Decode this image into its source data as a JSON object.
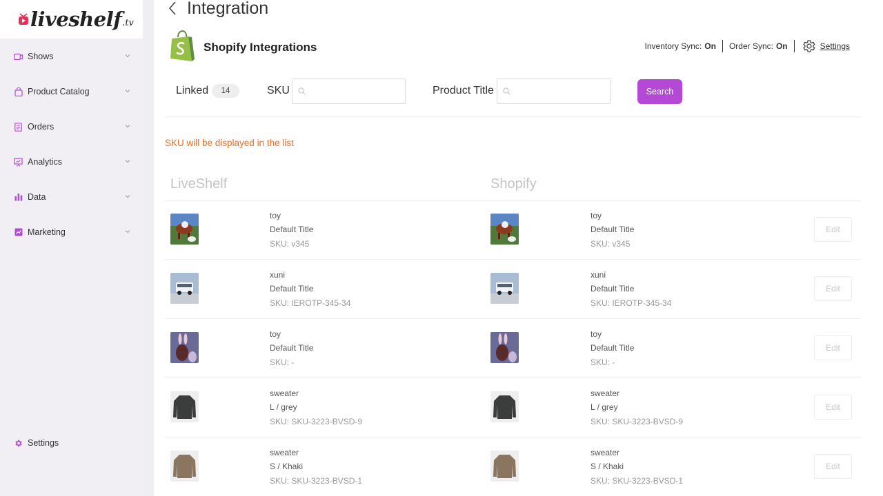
{
  "brand": {
    "name": "liveshelf",
    "tld": ".tv"
  },
  "sidebar": {
    "items": [
      {
        "label": "Shows",
        "icon": "video-icon"
      },
      {
        "label": "Product Catalog",
        "icon": "shopping-bag-icon"
      },
      {
        "label": "Orders",
        "icon": "document-icon"
      },
      {
        "label": "Analytics",
        "icon": "presentation-chart-icon"
      },
      {
        "label": "Data",
        "icon": "bar-chart-icon"
      },
      {
        "label": "Marketing",
        "icon": "trend-chart-icon"
      }
    ],
    "settings_label": "Settings"
  },
  "header": {
    "title": "Integration",
    "section_title": "Shopify Integrations",
    "inventory_sync_label": "Inventory Sync:",
    "inventory_sync_value": "On",
    "order_sync_label": "Order Sync:",
    "order_sync_value": "On",
    "settings_link": "Settings"
  },
  "filters": {
    "linked_label": "Linked",
    "linked_count": "14",
    "sku_label": "SKU",
    "sku_value": "",
    "title_label": "Product Title",
    "title_value": "",
    "search_button": "Search"
  },
  "notice": "SKU will be displayed in the list",
  "columns": {
    "left": "LiveShelf",
    "right": "Shopify"
  },
  "edit_label": "Edit",
  "colors": {
    "accent": "#b449d6",
    "notice": "#ef6c1e"
  },
  "rows": [
    {
      "name": "toy",
      "variant": "Default Title",
      "sku": "SKU: v345",
      "image": "cow"
    },
    {
      "name": "xuni",
      "variant": "Default Title",
      "sku": "SKU: IEROTP-345-34",
      "image": "car"
    },
    {
      "name": "toy",
      "variant": "Default Title",
      "sku": "SKU: -",
      "image": "bunny"
    },
    {
      "name": "sweater",
      "variant": "L / grey",
      "sku": "SKU: SKU-3223-BVSD-9",
      "image": "grey-sweater"
    },
    {
      "name": "sweater",
      "variant": "S / Khaki",
      "sku": "SKU: SKU-3223-BVSD-1",
      "image": "khaki-sweater"
    }
  ]
}
